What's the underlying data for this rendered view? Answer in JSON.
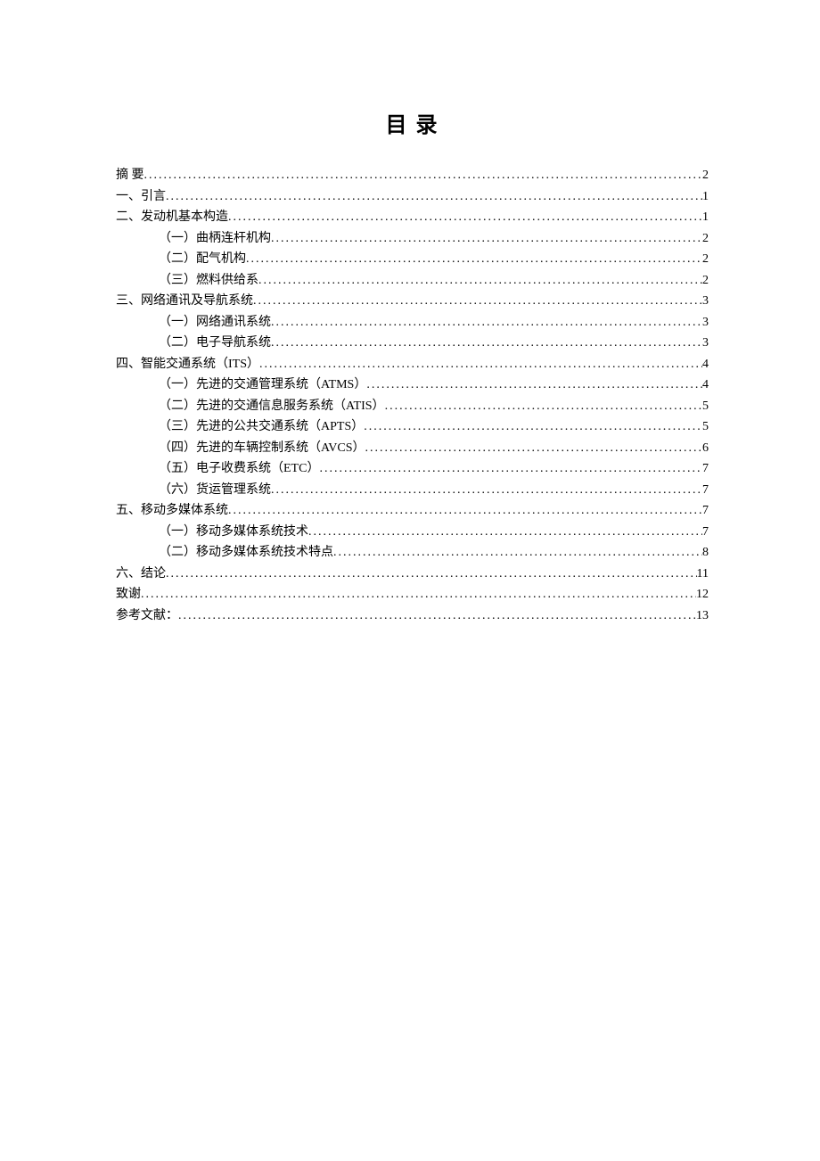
{
  "title": "目 录",
  "entries": [
    {
      "level": 1,
      "label": "摘 要",
      "page": "2"
    },
    {
      "level": 1,
      "label": "一、引言",
      "page": "1"
    },
    {
      "level": 1,
      "label": "二、发动机基本构造",
      "page": "1"
    },
    {
      "level": 2,
      "label": "（一）曲柄连杆机构",
      "page": "2"
    },
    {
      "level": 2,
      "label": "（二）配气机构",
      "page": "2"
    },
    {
      "level": 2,
      "label": "（三）燃料供给系",
      "page": "2"
    },
    {
      "level": 1,
      "label": "三、网络通讯及导航系统",
      "page": "3"
    },
    {
      "level": 2,
      "label": "（一）网络通讯系统",
      "page": "3"
    },
    {
      "level": 2,
      "label": "（二）电子导航系统",
      "page": "3"
    },
    {
      "level": 1,
      "label": "四、智能交通系统（ITS）",
      "page": "4"
    },
    {
      "level": 2,
      "label": "（一）先进的交通管理系统（ATMS）",
      "page": "4"
    },
    {
      "level": 2,
      "label": "（二）先进的交通信息服务系统（ATIS）",
      "page": "5"
    },
    {
      "level": 2,
      "label": "（三）先进的公共交通系统（APTS）",
      "page": "5"
    },
    {
      "level": 2,
      "label": "（四）先进的车辆控制系统（AVCS）",
      "page": "6"
    },
    {
      "level": 2,
      "label": "（五）电子收费系统（ETC）",
      "page": "7"
    },
    {
      "level": 2,
      "label": "（六）货运管理系统",
      "page": "7"
    },
    {
      "level": 1,
      "label": "五、移动多媒体系统",
      "page": "7"
    },
    {
      "level": 2,
      "label": "（一）移动多媒体系统技术",
      "page": "7"
    },
    {
      "level": 2,
      "label": "（二）移动多媒体系统技术特点",
      "page": "8"
    },
    {
      "level": 1,
      "label": "六、结论",
      "page": "11"
    },
    {
      "level": 1,
      "label": "致谢",
      "page": "12"
    },
    {
      "level": 1,
      "label": "参考文献：",
      "page": "13"
    }
  ]
}
